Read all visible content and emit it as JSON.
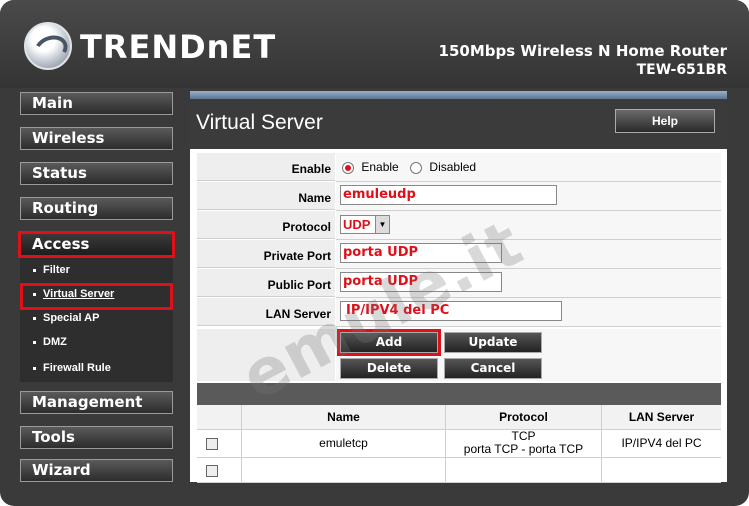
{
  "header": {
    "brand": "TRENDnET",
    "product_line": "150Mbps Wireless N Home Router",
    "model": "TEW-651BR"
  },
  "nav": {
    "main": "Main",
    "wireless": "Wireless",
    "status": "Status",
    "routing": "Routing",
    "access": "Access",
    "management": "Management",
    "tools": "Tools",
    "wizard": "Wizard",
    "access_sub": [
      "Filter",
      "Virtual Server",
      "Special AP",
      "DMZ",
      "Firewall Rule"
    ]
  },
  "page": {
    "title": "Virtual Server",
    "help_label": "Help"
  },
  "form": {
    "enable_label": "Enable",
    "enable_option": "Enable",
    "disabled_option": "Disabled",
    "name_label": "Name",
    "name_value": "emuleudp",
    "protocol_label": "Protocol",
    "protocol_value": "UDP",
    "private_port_label": "Private Port",
    "private_port_value": "porta UDP",
    "public_port_label": "Public Port",
    "public_port_value": "porta UDP",
    "lan_server_label": "LAN Server",
    "lan_server_value": "IP/IPV4 del PC"
  },
  "buttons": {
    "add": "Add",
    "update": "Update",
    "delete": "Delete",
    "cancel": "Cancel"
  },
  "table": {
    "headers": [
      "Name",
      "Protocol",
      "LAN Server"
    ],
    "rows": [
      {
        "name": "emuletcp",
        "protocol": "TCP",
        "ports": "porta TCP - porta TCP",
        "lan_server": "IP/IPV4 del PC"
      }
    ]
  },
  "watermark": "emule.it",
  "colors": {
    "highlight_red": "#e0101a",
    "panel_dark": "#3b3b3b"
  }
}
